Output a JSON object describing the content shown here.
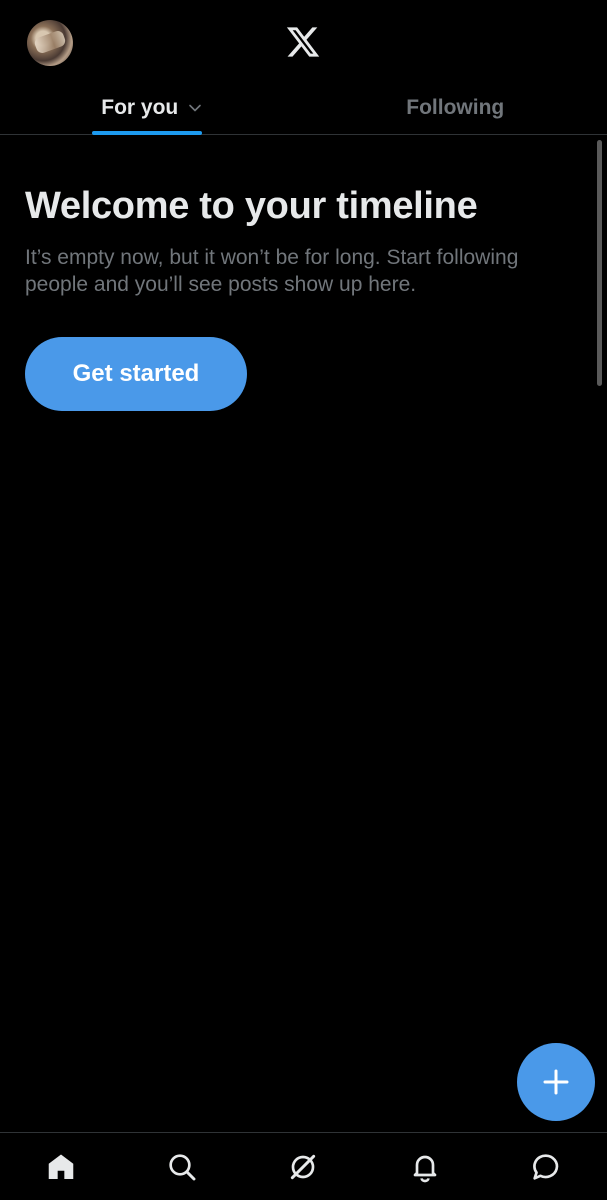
{
  "header": {
    "avatar_icon": "profile-avatar",
    "logo_icon": "x-logo-icon"
  },
  "tabs": [
    {
      "label": "For you",
      "active": true,
      "has_dropdown": true
    },
    {
      "label": "Following",
      "active": false
    }
  ],
  "timeline": {
    "title": "Welcome to your timeline",
    "text": "It’s empty now, but it won’t be for long. Start following people and you’ll see posts show up here.",
    "cta_label": "Get started"
  },
  "fab": {
    "icon": "plus-icon"
  },
  "bottom_nav": [
    {
      "icon": "home-icon"
    },
    {
      "icon": "search-icon"
    },
    {
      "icon": "grok-icon"
    },
    {
      "icon": "bell-icon"
    },
    {
      "icon": "messages-icon"
    }
  ],
  "colors": {
    "background": "#000000",
    "accent": "#1d9bf0",
    "button": "#4a99e9",
    "muted_text": "#71767b",
    "primary_text": "#e7e9ea",
    "divider": "#2f3336"
  }
}
